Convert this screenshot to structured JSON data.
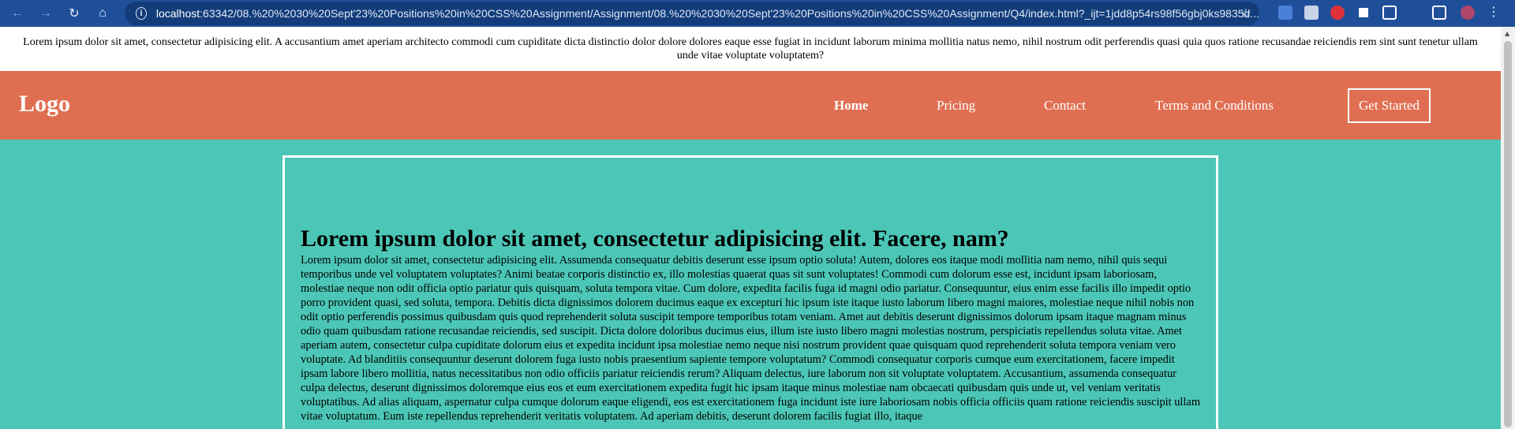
{
  "browser": {
    "url_host": "localhost",
    "url_rest": ":63342/08.%20%2030%20Sept'23%20Positions%20in%20CSS%20Assignment/Assignment/08.%20%2030%20Sept'23%20Positions%20in%20CSS%20Assignment/Q4/index.html?_ijt=1jdd8p54rs98f56gbj0ks9835d...",
    "icons": [
      "back-icon",
      "forward-icon",
      "reload-icon",
      "home-icon",
      "info-icon",
      "star-icon"
    ]
  },
  "banner": {
    "text": "Lorem ipsum dolor sit amet, consectetur adipisicing elit. A accusantium amet aperiam architecto commodi cum cupiditate dicta distinctio dolor dolore dolores eaque esse fugiat in incidunt laborum minima mollitia natus nemo, nihil nostrum odit perferendis quasi quia quos ratione recusandae reiciendis rem sint sunt tenetur ullam unde vitae voluptate voluptatem?"
  },
  "header": {
    "logo": "Logo",
    "nav": [
      "Home",
      "Pricing",
      "Contact",
      "Terms and Conditions"
    ],
    "cta": "Get Started"
  },
  "main": {
    "heading": "Lorem ipsum dolor sit amet, consectetur adipisicing elit. Facere, nam?",
    "body": "Lorem ipsum dolor sit amet, consectetur adipisicing elit. Assumenda consequatur debitis deserunt esse ipsum optio soluta! Autem, dolores eos itaque modi mollitia nam nemo, nihil quis sequi temporibus unde vel voluptatem voluptates? Animi beatae corporis distinctio ex, illo molestias quaerat quas sit sunt voluptates! Commodi cum dolorum esse est, incidunt ipsam laboriosam, molestiae neque non odit officia optio pariatur quis quisquam, soluta tempora vitae. Cum dolore, expedita facilis fuga id magni odio pariatur. Consequuntur, eius enim esse facilis illo impedit optio porro provident quasi, sed soluta, tempora. Debitis dicta dignissimos dolorem ducimus eaque ex excepturi hic ipsum iste itaque iusto laborum libero magni maiores, molestiae neque nihil nobis non odit optio perferendis possimus quibusdam quis quod reprehenderit soluta suscipit tempore temporibus totam veniam. Amet aut debitis deserunt dignissimos dolorum ipsam itaque magnam minus odio quam quibusdam ratione recusandae reiciendis, sed suscipit. Dicta dolore doloribus ducimus eius, illum iste iusto libero magni molestias nostrum, perspiciatis repellendus soluta vitae. Amet aperiam autem, consectetur culpa cupiditate dolorum eius et expedita incidunt ipsa molestiae nemo neque nisi nostrum provident quae quisquam quod reprehenderit soluta tempora veniam vero voluptate. Ad blanditiis consequuntur deserunt dolorem fuga iusto nobis praesentium sapiente tempore voluptatum? Commodi consequatur corporis cumque eum exercitationem, facere impedit ipsam labore libero mollitia, natus necessitatibus non odio officiis pariatur reiciendis rerum? Aliquam delectus, iure laborum non sit voluptate voluptatem. Accusantium, assumenda consequatur culpa delectus, deserunt dignissimos doloremque eius eos et eum exercitationem expedita fugit hic ipsam itaque minus molestiae nam obcaecati quibusdam quis unde ut, vel veniam veritatis voluptatibus. Ad alias aliquam, aspernatur culpa cumque dolorum eaque eligendi, eos est exercitationem fuga incidunt iste iure laboriosam nobis officia officiis quam ratione reiciendis suscipit ullam vitae voluptatum. Eum iste repellendus reprehenderit veritatis voluptatem. Ad aperiam debitis, deserunt dolorem facilis fugiat illo, itaque"
  },
  "colors": {
    "header_bg": "#e06f52",
    "page_bg": "#4cc7b7",
    "browser_bar": "#1f4f99"
  }
}
